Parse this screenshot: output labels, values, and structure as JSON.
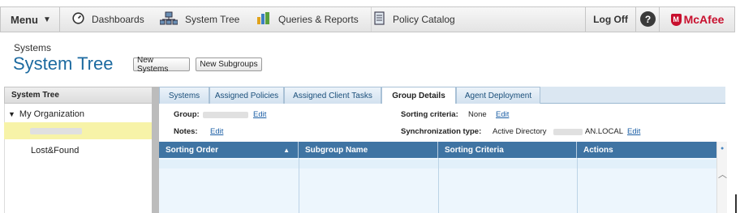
{
  "nav": {
    "menu_label": "Menu",
    "items": [
      {
        "label": "Dashboards",
        "icon": "dashboard-gauge-icon"
      },
      {
        "label": "System Tree",
        "icon": "network-computers-icon"
      },
      {
        "label": "Queries & Reports",
        "icon": "reports-chart-icon"
      },
      {
        "label": "Policy Catalog",
        "icon": "policy-document-icon"
      }
    ],
    "logoff_label": "Log Off",
    "help_label": "?",
    "brand": "McAfee",
    "brand_color": "#c8102e"
  },
  "page": {
    "breadcrumb": "Systems",
    "title": "System Tree",
    "new_systems_label": "New Systems",
    "new_subgroups_label": "New Subgroups",
    "title_color": "#1c6aa0"
  },
  "tree": {
    "header": "System Tree",
    "root_label": "My Organization",
    "selected_group": "",
    "lost_found_label": "Lost&Found"
  },
  "tabs": [
    {
      "label": "Systems",
      "active": false
    },
    {
      "label": "Assigned Policies",
      "active": false
    },
    {
      "label": "Assigned Client Tasks",
      "active": false
    },
    {
      "label": "Group Details",
      "active": true
    },
    {
      "label": "Agent Deployment",
      "active": false
    }
  ],
  "details": {
    "group_label": "Group:",
    "group_value": "",
    "notes_label": "Notes:",
    "sorting_label": "Sorting criteria:",
    "sorting_value": "None",
    "sync_label": "Synchronization type:",
    "sync_value": "Active Directory",
    "sync_domain_suffix": "AN.LOCAL",
    "edit_label": "Edit"
  },
  "grid": {
    "columns": [
      "Sorting Order",
      "Subgroup Name",
      "Sorting Criteria",
      "Actions"
    ],
    "sort_indicator": "▲",
    "header_color": "#3f74a3"
  }
}
